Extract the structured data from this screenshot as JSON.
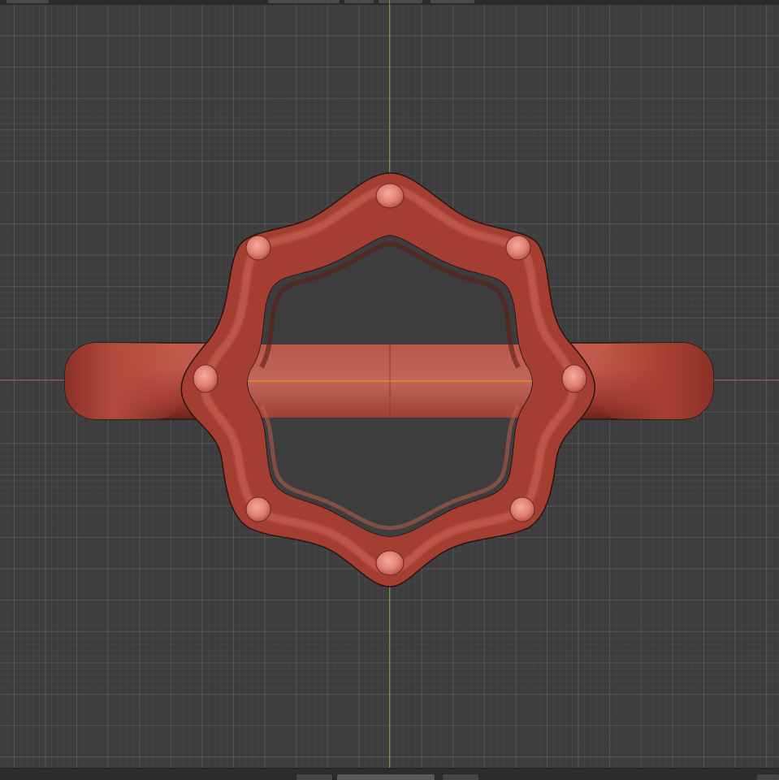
{
  "viewport": {
    "background_color": "#3d3d3d",
    "grid_color": "#4a4a4a",
    "x_axis_color": "#b44848",
    "y_axis_color": "#7ea234",
    "object_color": "#b5473c",
    "bead_color": "#e38a80",
    "selection_edge_color": "#e8901f"
  },
  "objects": {
    "ring_band": {
      "name_icon": "ring-band-mesh"
    },
    "setting_frame": {
      "name_icon": "octagonal-wave-frame-mesh",
      "bead_count": 8
    }
  },
  "icons": {
    "header": [
      "view-menu-widget",
      "shading-widget",
      "overlay-widget",
      "gizmo-widget"
    ],
    "footer": [
      "timeline-widget",
      "playback-widget",
      "frame-widget"
    ]
  }
}
